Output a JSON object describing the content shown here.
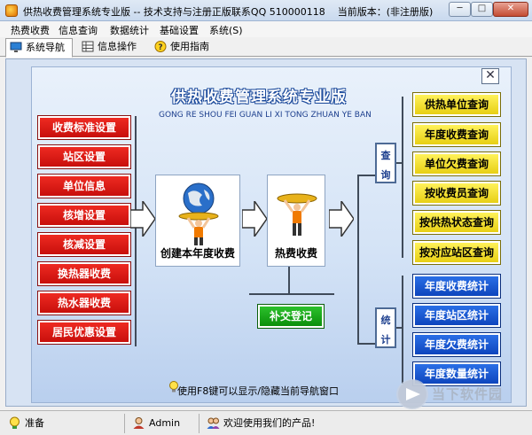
{
  "window": {
    "title": "供热收费管理系统专业版 -- 技术支持与注册正版联系QQ 510000118",
    "version_label": "当前版本：",
    "version_value": "(非注册版)",
    "min_label": "─",
    "max_label": "□",
    "close_label": "✕"
  },
  "menu": {
    "items": [
      "热费收费",
      "信息查询",
      "数据统计",
      "基础设置",
      "系统(S)"
    ]
  },
  "tabs": [
    {
      "label": "系统导航",
      "icon": "monitor-icon",
      "active": true
    },
    {
      "label": "信息操作",
      "icon": "grid-icon",
      "active": false
    },
    {
      "label": "使用指南",
      "icon": "help-icon",
      "active": false
    }
  ],
  "panel": {
    "close_label": "✕",
    "title": "供热收费管理系统专业版",
    "subtitle": "GONG RE SHOU FEI GUAN LI XI TONG ZHUAN YE BAN"
  },
  "left_buttons": [
    "收费标准设置",
    "站区设置",
    "单位信息",
    "核增设置",
    "核减设置",
    "换热器收费",
    "热水器收费",
    "居民优惠设置"
  ],
  "center": {
    "card1_label": "创建本年度收费",
    "card2_label": "热费收费",
    "supplement_label": "补交登记"
  },
  "side_boxes": {
    "query": [
      "查",
      "询"
    ],
    "stats": [
      "统",
      "计"
    ]
  },
  "query_buttons": [
    "供热单位查询",
    "年度收费查询",
    "单位欠费查询",
    "按收费员查询",
    "按供热状态查询",
    "按对应站区查询"
  ],
  "stats_buttons": [
    "年度收费统计",
    "年度站区统计",
    "年度欠费统计",
    "年度数量统计"
  ],
  "hint_text": "使用F8键可以显示/隐藏当前导航窗口",
  "watermark": {
    "text": "当下软件园"
  },
  "status": {
    "ready": "准备",
    "user": "Admin",
    "welcome": "欢迎使用我们的产品!"
  },
  "colors": {
    "red": "#d8150f",
    "green": "#14a014",
    "yellow": "#f5e137",
    "blue": "#1456d0",
    "navy": "#1d3f8e"
  }
}
